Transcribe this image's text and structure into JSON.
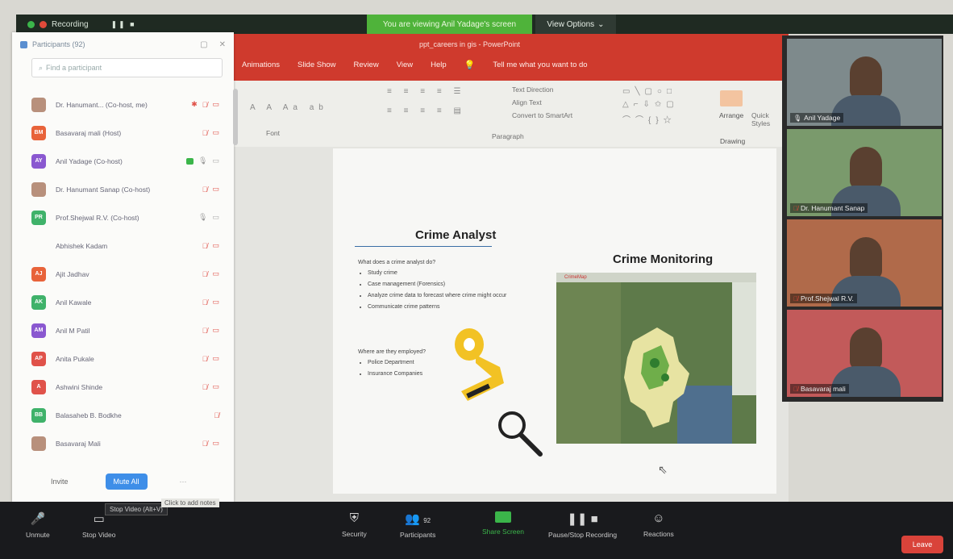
{
  "topbar": {
    "recording_label": "Recording",
    "pause_stop": "❚❚ ■"
  },
  "share_banner": "You are viewing Anil Yadage's screen",
  "view_options": "View Options",
  "ppt": {
    "title": "ppt_careers in gis - PowerPoint",
    "tabs": [
      "Animations",
      "Slide Show",
      "Review",
      "View",
      "Help"
    ],
    "tell_me": "Tell me what you want to do",
    "groups": {
      "font": "Font",
      "paragraph": "Paragraph",
      "drawing": "Drawing"
    },
    "ribbon_items": {
      "text_direction": "Text Direction",
      "align_text": "Align Text",
      "convert_smartart": "Convert to SmartArt",
      "arrange": "Arrange",
      "quick_styles": "Quick Styles"
    }
  },
  "slide": {
    "left_title": "Crime Analyst",
    "question1": "What does a crime analyst do?",
    "bullets1": [
      "Study crime",
      "Case management (Forensics)",
      "Analyze crime data to forecast where crime might occur",
      "Communicate crime patterns"
    ],
    "question2": "Where are they employed?",
    "bullets2": [
      "Police Department",
      "Insurance Companies"
    ],
    "right_title": "Crime Monitoring",
    "map_header": "CrimeMap"
  },
  "panel": {
    "title": "Participants (92)",
    "search_placeholder": "Find a participant",
    "participants": [
      {
        "name": "Dr. Hanumant... (Co-host, me)",
        "initials": "",
        "color": "#b8907c",
        "mic": "off",
        "cam": "off",
        "hand": true
      },
      {
        "name": "Basavaraj mali (Host)",
        "initials": "BM",
        "color": "#e8633a",
        "mic": "off",
        "cam": "off"
      },
      {
        "name": "Anil Yadage (Co-host)",
        "initials": "AY",
        "color": "#8a58d0",
        "mic": "on",
        "cam": "on",
        "sharing": true
      },
      {
        "name": "Dr. Hanumant Sanap (Co-host)",
        "initials": "",
        "color": "#b8907c",
        "mic": "off",
        "cam": "off"
      },
      {
        "name": "Prof.Shejwal R.V. (Co-host)",
        "initials": "PR",
        "color": "#3fb26a",
        "mic": "on",
        "cam": "on"
      },
      {
        "name": "Abhishek Kadam",
        "initials": "",
        "color": "transparent",
        "mic": "off",
        "cam": "off"
      },
      {
        "name": "Ajit Jadhav",
        "initials": "AJ",
        "color": "#e8633a",
        "mic": "off",
        "cam": "off"
      },
      {
        "name": "Anil Kawale",
        "initials": "AK",
        "color": "#3fb26a",
        "mic": "off",
        "cam": "off"
      },
      {
        "name": "Anil M Patil",
        "initials": "AM",
        "color": "#8a58d0",
        "mic": "off",
        "cam": "off"
      },
      {
        "name": "Anita Pukale",
        "initials": "AP",
        "color": "#e0524a",
        "mic": "off",
        "cam": "off"
      },
      {
        "name": "Ashwini Shinde",
        "initials": "A",
        "color": "#e0524a",
        "mic": "off",
        "cam": "off"
      },
      {
        "name": "Balasaheb B. Bodkhe",
        "initials": "BB",
        "color": "#3fb26a",
        "mic": "off",
        "cam": "none"
      },
      {
        "name": "Basavaraj Mali",
        "initials": "",
        "color": "#b8907c",
        "mic": "off",
        "cam": "off"
      }
    ],
    "invite": "Invite",
    "mute_all": "Mute All",
    "more": "···"
  },
  "tiles": [
    {
      "name": "Anil Yadage",
      "mic": "on",
      "bg": "#7e8a8c"
    },
    {
      "name": "Dr. Hanumant Sanap",
      "mic": "off",
      "bg": "#7a9a6c"
    },
    {
      "name": "Prof.Shejwal R.V.",
      "mic": "off",
      "bg": "#b06a4a"
    },
    {
      "name": "Basavaraj mali",
      "mic": "off",
      "bg": "#c25a5a"
    }
  ],
  "toolbar": {
    "unmute": "Unmute",
    "stop_video": "Stop Video",
    "security": "Security",
    "participants": "Participants",
    "participants_count": "92",
    "share_screen": "Share Screen",
    "record": "Pause/Stop Recording",
    "reactions": "Reactions",
    "leave": "Leave",
    "tooltip": "Stop Video (Alt+V)",
    "tooltip2": "Click to add notes"
  }
}
